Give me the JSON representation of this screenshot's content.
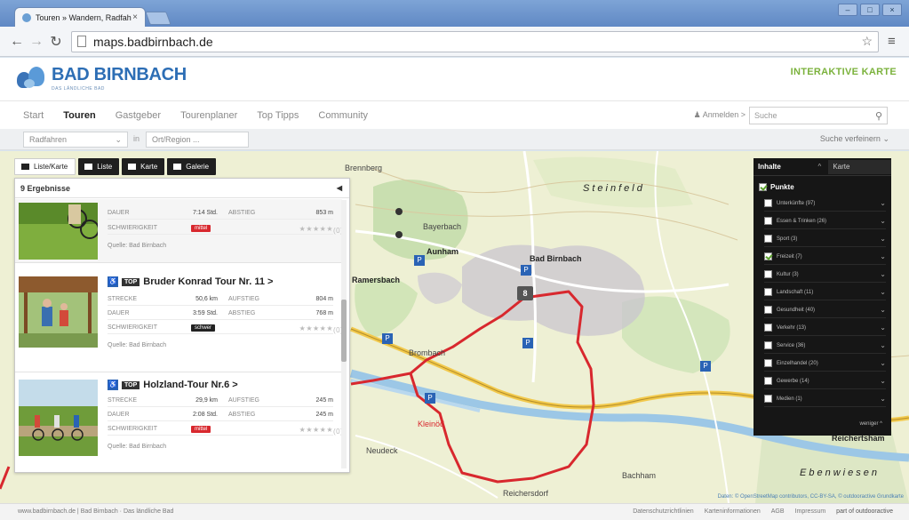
{
  "browser": {
    "tab_title": "Touren » Wandern, Radfah",
    "tab_close": "×",
    "url": "maps.badbirnbach.de",
    "win_buttons": [
      "–",
      "□",
      "×"
    ]
  },
  "site": {
    "logo_text": "BAD BIRNBACH",
    "logo_tagline": "DAS LÄNDLICHE BAD",
    "header_right": "INTERAKTIVE KARTE"
  },
  "nav": {
    "items": [
      "Start",
      "Touren",
      "Gastgeber",
      "Tourenplaner",
      "Top Tipps",
      "Community"
    ],
    "active_index": 1,
    "login": "Anmelden >",
    "search_placeholder": "Suche"
  },
  "filters": {
    "activity": "Radfahren",
    "separator": "in",
    "region": "Ort/Region ...",
    "refine": "Suche verfeinern"
  },
  "view_buttons": [
    "Liste/Karte",
    "Liste",
    "Karte",
    "Galerie"
  ],
  "results": {
    "count_label": "9 Ergebnisse",
    "items": [
      {
        "title": "",
        "rows": [
          {
            "k1": "DAUER",
            "v1": "7:14 Std.",
            "k2": "ABSTIEG",
            "v2": "853 m"
          },
          {
            "k1": "SCHWIERIGKEIT",
            "badge": "mittel",
            "badge_color": "red",
            "rating": "(0)"
          }
        ],
        "source": "Quelle: Bad Birnbach"
      },
      {
        "title": "Bruder Konrad Tour Nr. 11 >",
        "tag": "TOP",
        "rows": [
          {
            "k1": "STRECKE",
            "v1": "50,6 km",
            "k2": "AUFSTIEG",
            "v2": "804 m"
          },
          {
            "k1": "DAUER",
            "v1": "3:59 Std.",
            "k2": "ABSTIEG",
            "v2": "768 m"
          },
          {
            "k1": "SCHWIERIGKEIT",
            "badge": "schwer",
            "badge_color": "black",
            "rating": "(0)"
          }
        ],
        "source": "Quelle: Bad Birnbach"
      },
      {
        "title": "Holzland-Tour Nr.6 >",
        "tag": "TOP",
        "rows": [
          {
            "k1": "STRECKE",
            "v1": "29,9 km",
            "k2": "AUFSTIEG",
            "v2": "245 m"
          },
          {
            "k1": "DAUER",
            "v1": "2:08 Std.",
            "k2": "ABSTIEG",
            "v2": "245 m"
          },
          {
            "k1": "SCHWIERIGKEIT",
            "badge": "mittel",
            "badge_color": "red",
            "rating": "(0)"
          }
        ],
        "source": "Quelle: Bad Birnbach"
      }
    ]
  },
  "inhalte": {
    "label": "Inhalte",
    "map_select": "Karte",
    "punkte": "Punkte",
    "categories": [
      {
        "label": "Unterkünfte (97)",
        "checked": false
      },
      {
        "label": "Essen & Trinken (26)",
        "checked": false
      },
      {
        "label": "Sport (3)",
        "checked": false
      },
      {
        "label": "Freizeit (7)",
        "checked": true
      },
      {
        "label": "Kultur (3)",
        "checked": false
      },
      {
        "label": "Landschaft (11)",
        "checked": false
      },
      {
        "label": "Gesundheit (40)",
        "checked": false
      },
      {
        "label": "Verkehr (13)",
        "checked": false
      },
      {
        "label": "Service (36)",
        "checked": false
      },
      {
        "label": "Einzelhandel (20)",
        "checked": false
      },
      {
        "label": "Gewerbe (14)",
        "checked": false
      },
      {
        "label": "Medien (1)",
        "checked": false
      }
    ],
    "less": "weniger ^"
  },
  "map": {
    "labels": [
      "Bad Birnbach",
      "Aunham",
      "Steinfeld",
      "Bayerbach",
      "Brennberg",
      "Ramersbach",
      "Brombach",
      "Kleinöd",
      "Neudeck",
      "Reichertsham",
      "Ebenwiesen",
      "Bachham",
      "Reichersdorf"
    ],
    "route_color": "#d8282e",
    "attribution": "Daten: © OpenStreetMap contributors, CC-BY-SA, © outdooractive Grundkarte"
  },
  "footer": {
    "left": "www.badbirnbach.de | Bad Birnbach · Das ländliche Bad",
    "links": [
      "Datenschutzrichtlinien",
      "Karteninformationen",
      "AGB",
      "Impressum",
      "part of outdooractive"
    ]
  }
}
